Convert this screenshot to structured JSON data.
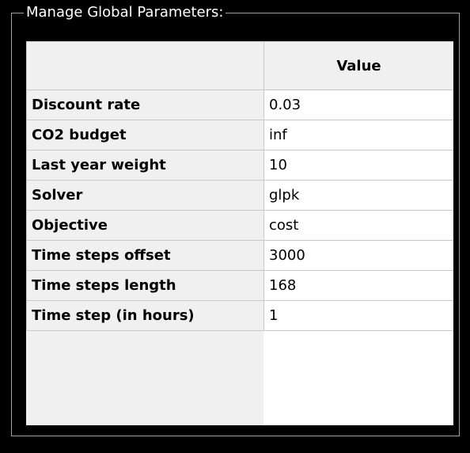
{
  "group": {
    "title": "Manage Global Parameters:"
  },
  "table": {
    "corner_label": "",
    "column_header": "Value",
    "rows": [
      {
        "name": "Discount rate",
        "value": "0.03"
      },
      {
        "name": "CO2 budget",
        "value": "inf"
      },
      {
        "name": "Last year weight",
        "value": "10"
      },
      {
        "name": "Solver",
        "value": "glpk"
      },
      {
        "name": "Objective",
        "value": "cost"
      },
      {
        "name": "Time steps offset",
        "value": "3000"
      },
      {
        "name": "Time steps length",
        "value": "168"
      },
      {
        "name": "Time step (in hours)",
        "value": "1"
      }
    ]
  }
}
